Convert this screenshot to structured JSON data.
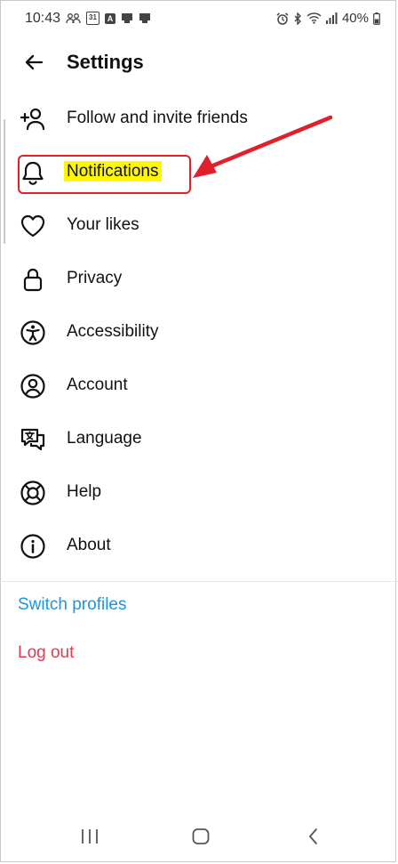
{
  "status_bar": {
    "time": "10:43",
    "calendar_day": "31",
    "battery": "40%",
    "icons_left": [
      "people-icon",
      "calendar-icon",
      "a-icon",
      "app-icon",
      "app-icon"
    ],
    "icons_right": [
      "alarm-icon",
      "bluetooth-icon",
      "wifi-icon",
      "signal-icon",
      "battery-icon"
    ]
  },
  "header": {
    "title": "Settings",
    "back_icon": "arrow-left-icon"
  },
  "menu": {
    "items": [
      {
        "label": "Follow and invite friends",
        "icon": "add-person-icon"
      },
      {
        "label": "Notifications",
        "icon": "bell-icon"
      },
      {
        "label": "Your likes",
        "icon": "heart-icon"
      },
      {
        "label": "Privacy",
        "icon": "lock-icon"
      },
      {
        "label": "Accessibility",
        "icon": "accessibility-icon"
      },
      {
        "label": "Account",
        "icon": "account-icon"
      },
      {
        "label": "Language",
        "icon": "language-icon"
      },
      {
        "label": "Help",
        "icon": "lifebuoy-icon"
      },
      {
        "label": "About",
        "icon": "info-icon"
      }
    ]
  },
  "links": {
    "switch_profiles": "Switch profiles",
    "log_out": "Log out"
  },
  "colors": {
    "link_blue": "#1a96e0",
    "logout_red": "#e23a4f",
    "highlight_yellow": "#fff700",
    "callout_red": "#e0202a"
  },
  "navigation_bar": [
    "recent-apps-icon",
    "home-icon",
    "back-icon"
  ]
}
